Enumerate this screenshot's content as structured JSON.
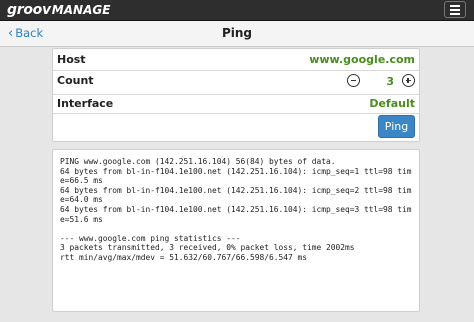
{
  "app": {
    "logo_part1": "groov",
    "logo_part2": "MANAGE"
  },
  "nav": {
    "back_label": "Back",
    "title": "Ping"
  },
  "form": {
    "host_label": "Host",
    "host_value": "www.google.com",
    "count_label": "Count",
    "count_value": "3",
    "interface_label": "Interface",
    "interface_value": "Default",
    "ping_button": "Ping"
  },
  "output": {
    "lines": [
      "PING www.google.com (142.251.16.104) 56(84) bytes of data.",
      "64 bytes from bl-in-f104.1e100.net (142.251.16.104): icmp_seq=1 ttl=98 time=66.5 ms",
      "64 bytes from bl-in-f104.1e100.net (142.251.16.104): icmp_seq=2 ttl=98 time=64.0 ms",
      "64 bytes from bl-in-f104.1e100.net (142.251.16.104): icmp_seq=3 ttl=98 time=51.6 ms",
      "",
      "--- www.google.com ping statistics ---",
      "3 packets transmitted, 3 received, 0% packet loss, time 2002ms",
      "rtt min/avg/max/mdev = 51.632/60.767/66.598/6.547 ms"
    ]
  },
  "colors": {
    "accent": "#3c86c6",
    "value_green": "#4a8c1f",
    "topbar": "#2e2e2e"
  }
}
